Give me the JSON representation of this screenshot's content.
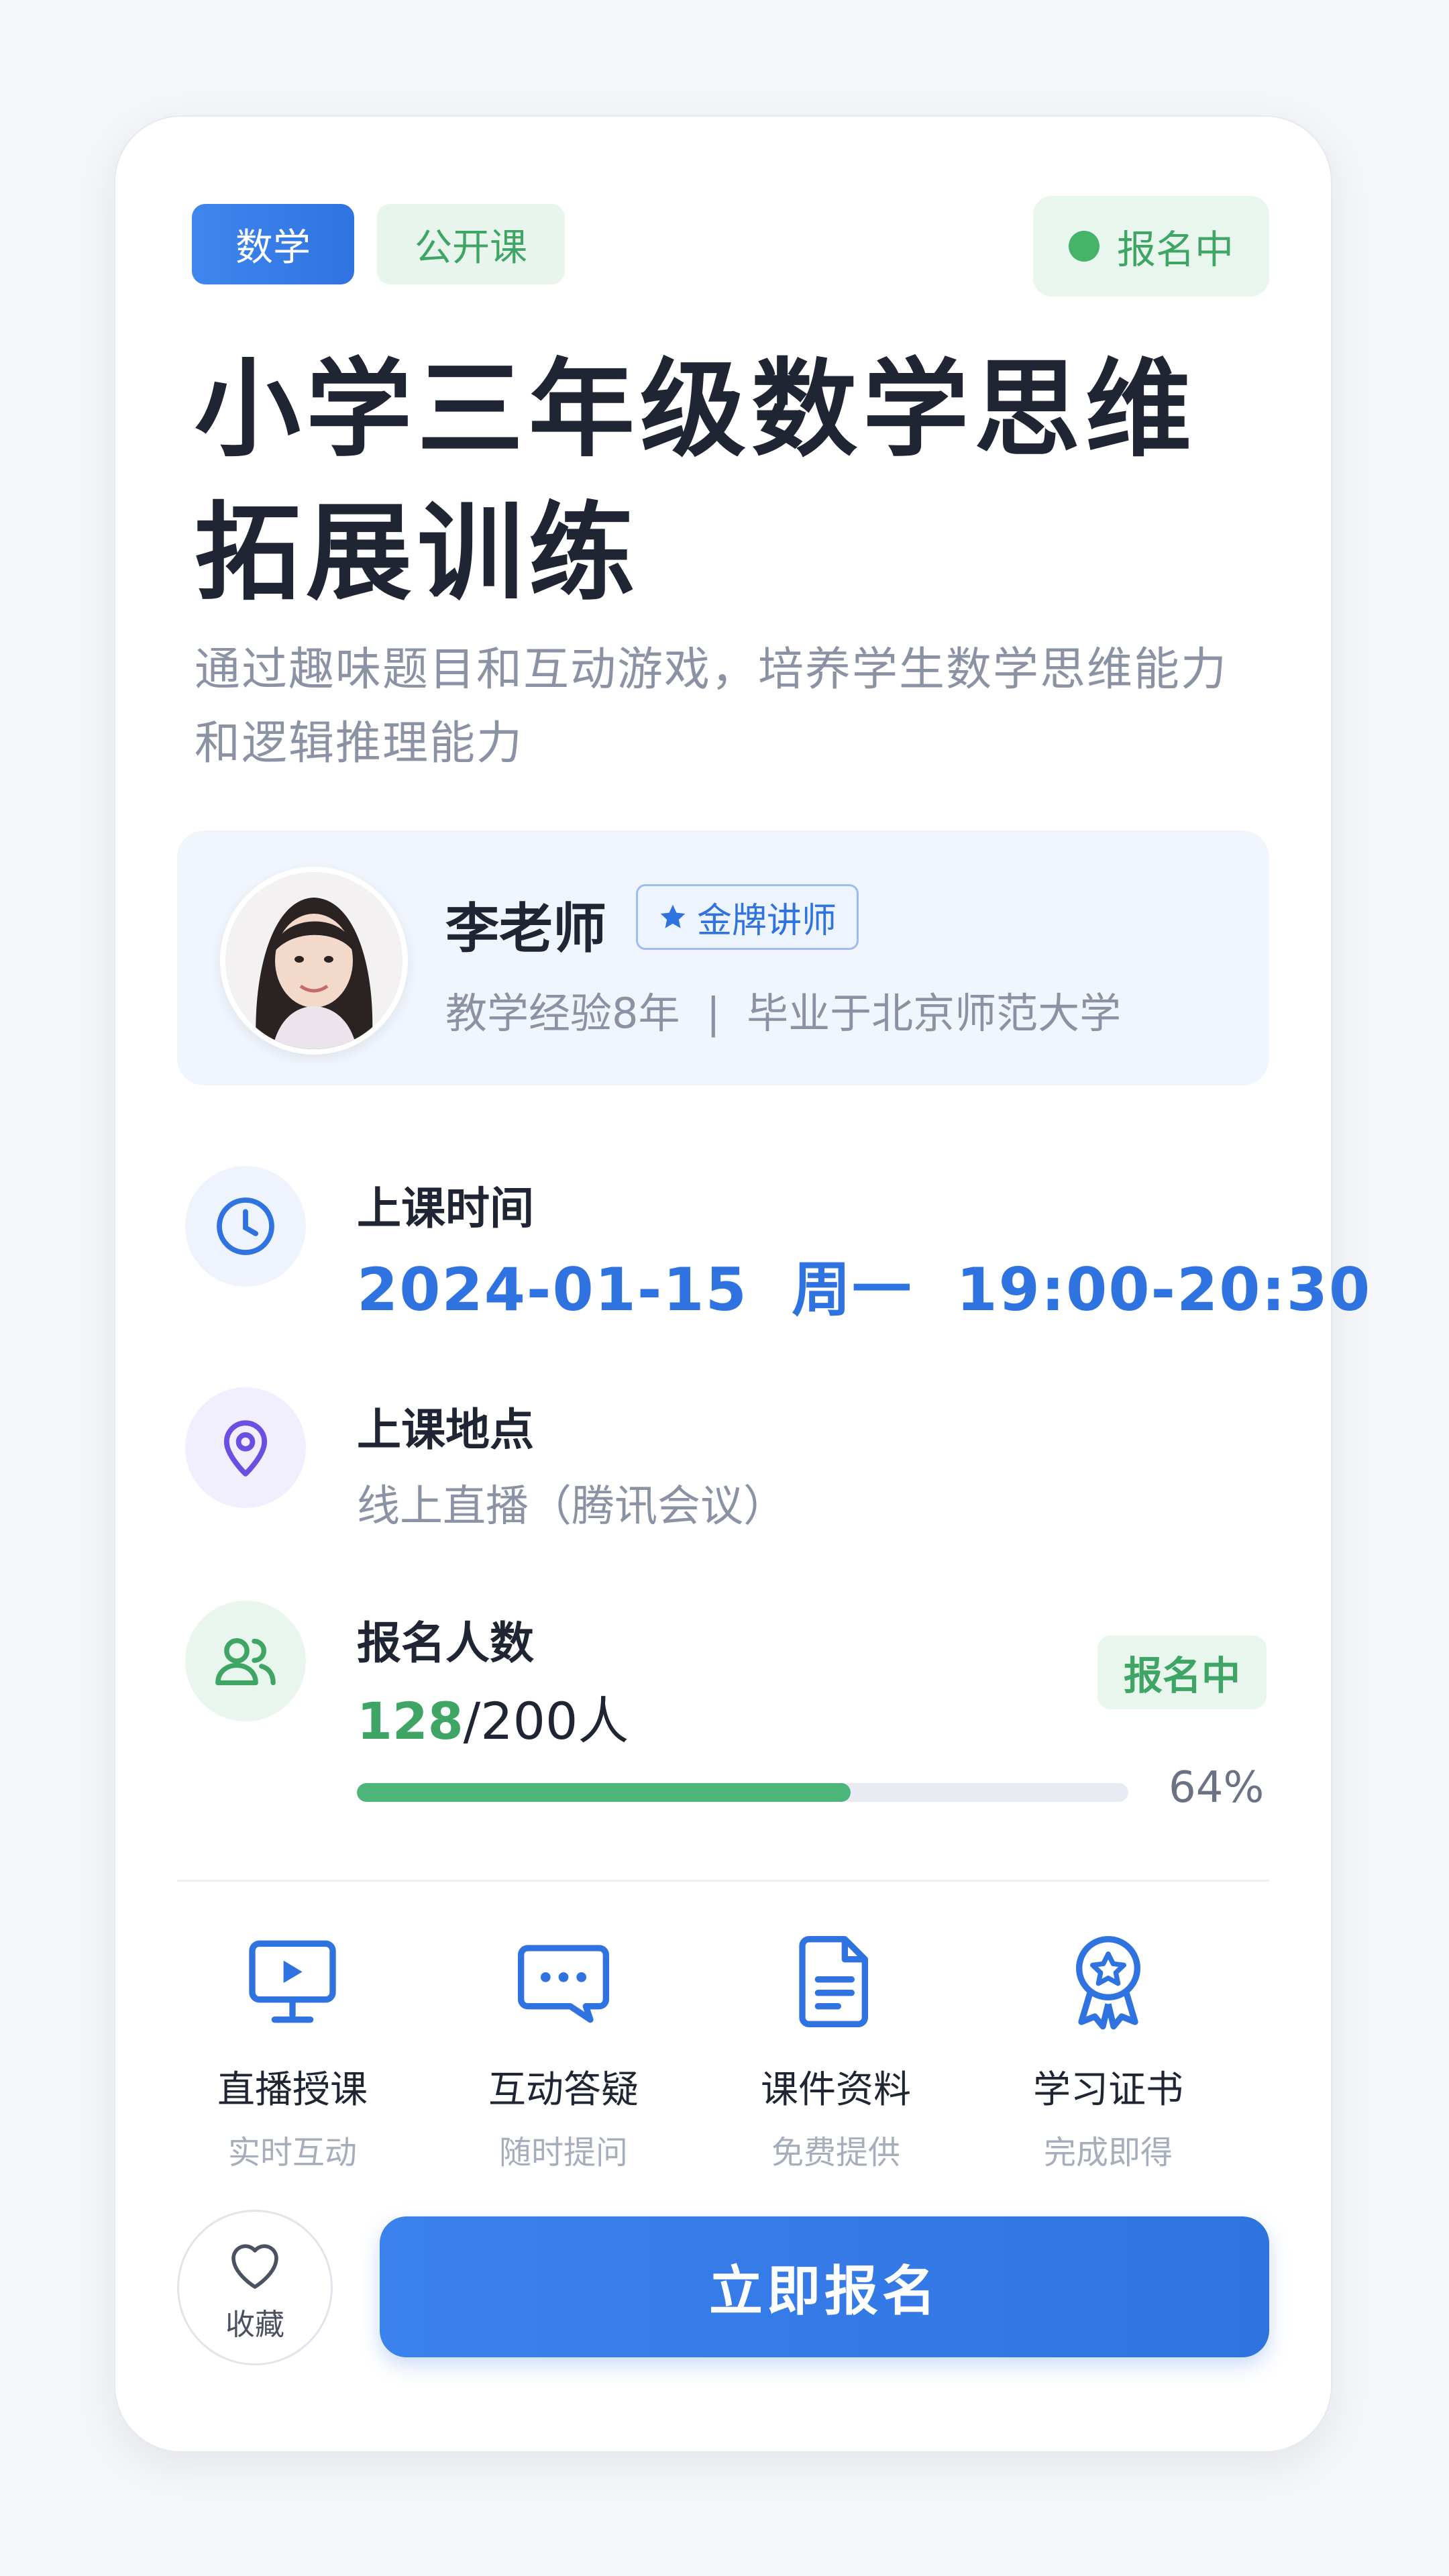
{
  "tags": {
    "subject": "数学",
    "type": "公开课"
  },
  "status": {
    "label": "报名中",
    "color": "#47b36a"
  },
  "course": {
    "title": "小学三年级数学思维拓展训练",
    "subtitle": "通过趣味题目和互动游戏，培养学生数学思维能力和逻辑推理能力"
  },
  "teacher": {
    "name": "李老师",
    "badge": "金牌讲师",
    "meta": "教学经验8年  |  毕业于北京师范大学"
  },
  "schedule": {
    "label": "上课时间",
    "value": "2024-01-15  周一  19:00-20:30"
  },
  "location": {
    "label": "上课地点",
    "value": "线上直播（腾讯会议）"
  },
  "enrollment": {
    "label": "报名人数",
    "current": "128",
    "total": "/200人",
    "status": "报名中",
    "percent_text": "64%",
    "progress": 0.64
  },
  "features": [
    {
      "name": "直播授课",
      "desc": "实时互动",
      "icon": "live-screen-icon"
    },
    {
      "name": "互动答疑",
      "desc": "随时提问",
      "icon": "chat-bubble-icon"
    },
    {
      "name": "课件资料",
      "desc": "免费提供",
      "icon": "document-icon"
    },
    {
      "name": "学习证书",
      "desc": "完成即得",
      "icon": "certificate-icon"
    }
  ],
  "footer": {
    "favorite_label": "收藏",
    "enroll_label": "立即报名"
  },
  "colors": {
    "primary": "#2f73e0",
    "success": "#3fa565",
    "muted": "#8a92a4"
  }
}
